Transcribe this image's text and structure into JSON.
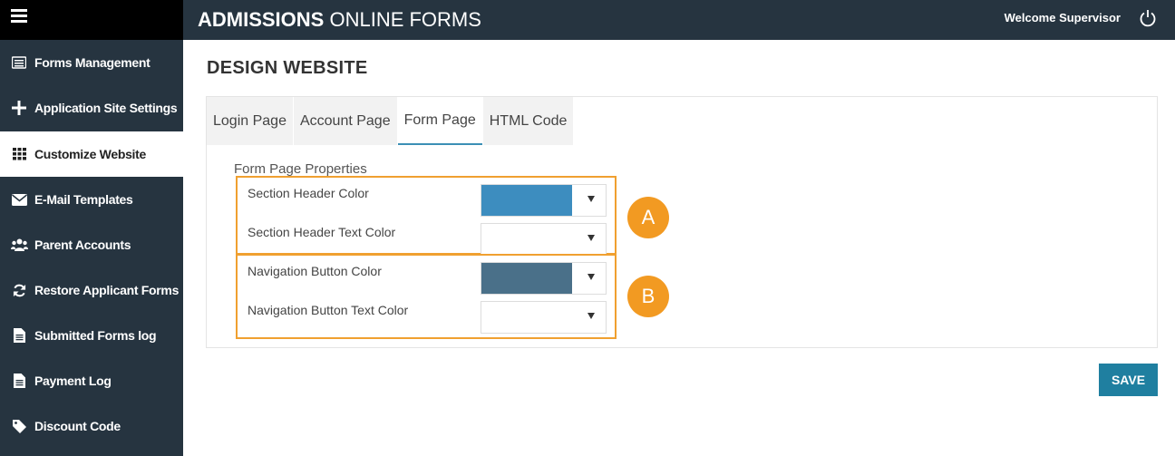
{
  "app": {
    "title_bold": "ADMISSIONS",
    "title_rest": " ONLINE FORMS",
    "welcome": "Welcome Supervisor"
  },
  "sidebar": {
    "items": [
      {
        "label": "Forms Management",
        "icon": "form-list-icon"
      },
      {
        "label": "Application Site Settings",
        "icon": "plus-icon"
      },
      {
        "label": "Customize Website",
        "icon": "grid-icon",
        "active": true
      },
      {
        "label": "E-Mail Templates",
        "icon": "envelope-icon"
      },
      {
        "label": "Parent Accounts",
        "icon": "users-icon"
      },
      {
        "label": "Restore Applicant Forms",
        "icon": "refresh-icon"
      },
      {
        "label": "Submitted Forms log",
        "icon": "document-icon"
      },
      {
        "label": "Payment Log",
        "icon": "document-icon"
      },
      {
        "label": "Discount Code",
        "icon": "tag-icon"
      }
    ]
  },
  "page": {
    "title": "DESIGN WEBSITE"
  },
  "tabs": [
    {
      "label": "Login Page"
    },
    {
      "label": "Account Page"
    },
    {
      "label": "Form Page",
      "active": true
    },
    {
      "label": "HTML Code"
    }
  ],
  "form": {
    "section_title": "Form Page Properties",
    "rows": [
      {
        "label": "Section Header Color",
        "color": "#3d8dbf"
      },
      {
        "label": "Section Header Text Color",
        "color": "#ffffff"
      },
      {
        "label": "Navigation Button Color",
        "color": "#4a7089"
      },
      {
        "label": "Navigation Button Text Color",
        "color": "#ffffff"
      }
    ]
  },
  "annotations": {
    "a": "A",
    "b": "B"
  },
  "actions": {
    "save": "SAVE"
  },
  "colors": {
    "sidebar": "#263440",
    "accent": "#f29a22",
    "save": "#1f7fa0"
  }
}
